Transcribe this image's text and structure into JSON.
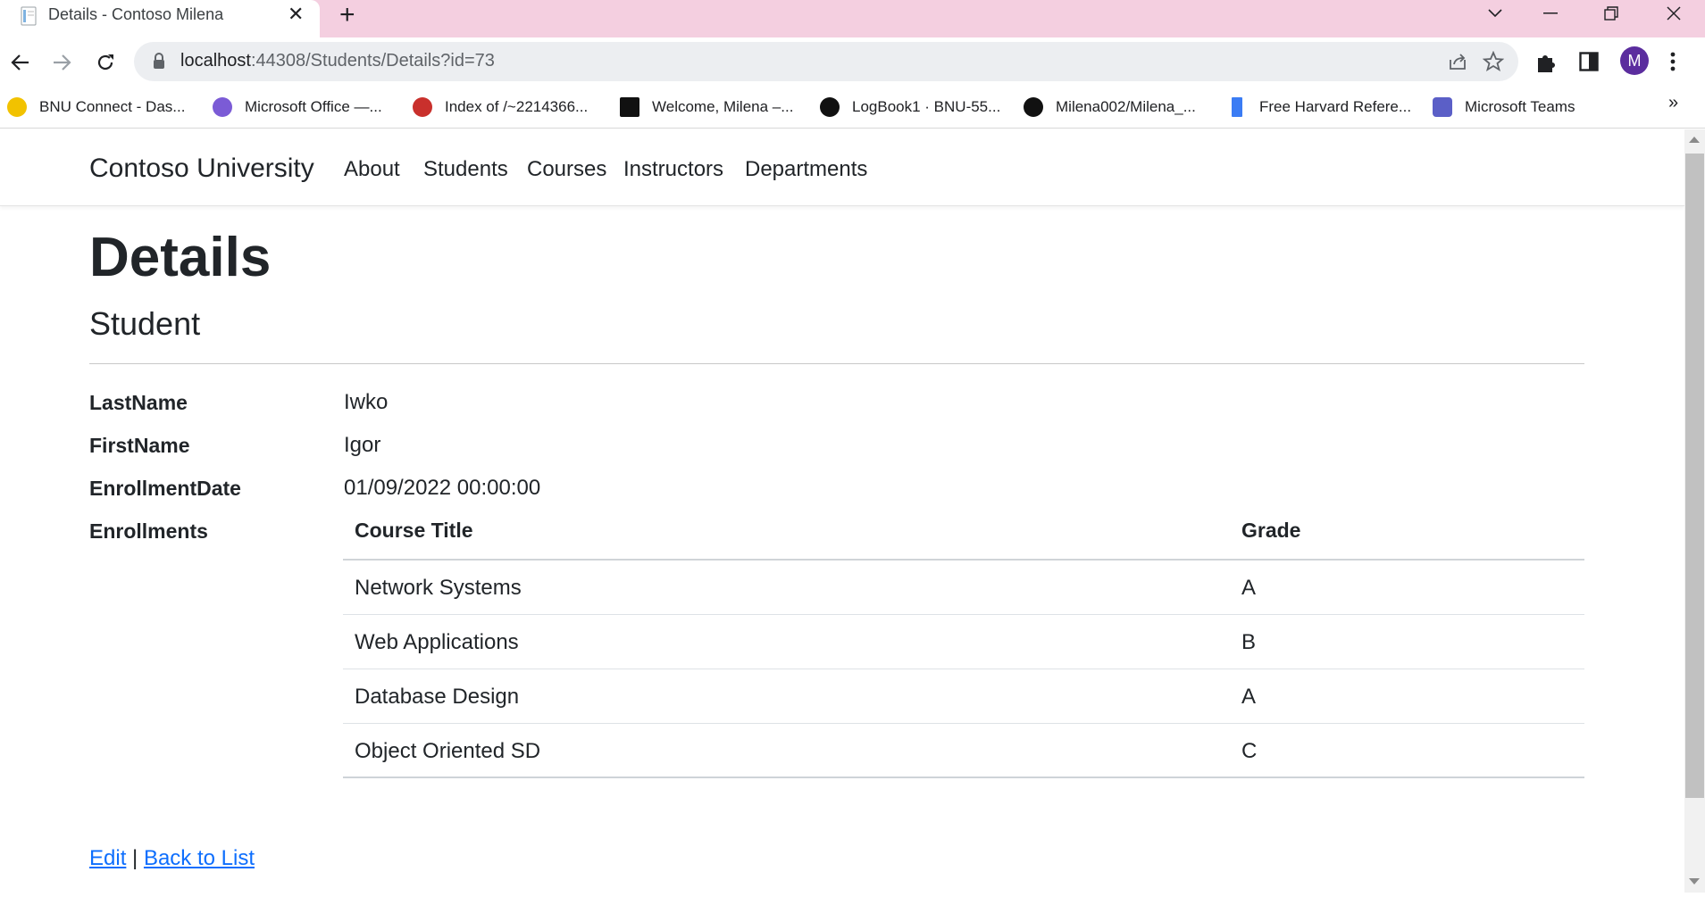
{
  "browser": {
    "tab_title": "Details - Contoso Milena",
    "url_host": "localhost",
    "url_rest": ":44308/Students/Details?id=73",
    "avatar_letter": "M",
    "bookmarks": [
      {
        "label": "BNU Connect - Das...",
        "icon": "bnu-icon",
        "color": "#f2c200"
      },
      {
        "label": "Microsoft Office —...",
        "icon": "office-icon",
        "color": "#7b5bd6"
      },
      {
        "label": "Index of /~2214366...",
        "icon": "chrome-like-icon",
        "color": "#c9302c"
      },
      {
        "label": "Welcome, Milena –...",
        "icon": "blackboard-icon",
        "color": "#111111"
      },
      {
        "label": "LogBook1 · BNU-55...",
        "icon": "github-icon",
        "color": "#111111"
      },
      {
        "label": "Milena002/Milena_...",
        "icon": "github-icon",
        "color": "#111111"
      },
      {
        "label": "Free Harvard Refere...",
        "icon": "bookmark-icon",
        "color": "#3b7cf4"
      },
      {
        "label": "Microsoft Teams",
        "icon": "teams-icon",
        "color": "#5b5fc7"
      }
    ],
    "more_bookmarks": "»"
  },
  "site": {
    "brand": "Contoso University",
    "nav": [
      "About",
      "Students",
      "Courses",
      "Instructors",
      "Departments"
    ]
  },
  "page": {
    "title": "Details",
    "subtitle": "Student",
    "fields": [
      {
        "label": "LastName",
        "value": "Iwko"
      },
      {
        "label": "FirstName",
        "value": "Igor"
      },
      {
        "label": "EnrollmentDate",
        "value": "01/09/2022 00:00:00"
      },
      {
        "label": "Enrollments",
        "value": ""
      }
    ],
    "enrollments": {
      "headers": [
        "Course Title",
        "Grade"
      ],
      "rows": [
        [
          "Network Systems",
          "A"
        ],
        [
          "Web Applications",
          "B"
        ],
        [
          "Database Design",
          "A"
        ],
        [
          "Object Oriented SD",
          "C"
        ]
      ]
    },
    "edit_link": "Edit",
    "separator": "|",
    "back_link": "Back to List"
  }
}
